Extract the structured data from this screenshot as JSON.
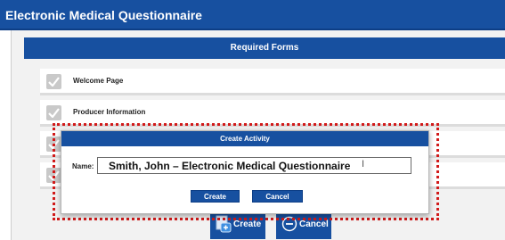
{
  "app": {
    "title": "Electronic Medical Questionnaire"
  },
  "required_forms": {
    "title": "Required Forms",
    "items": [
      {
        "label": "Welcome Page",
        "completed": true
      },
      {
        "label": "Producer Information",
        "completed": true
      },
      {
        "label": "",
        "completed": true
      },
      {
        "label": "",
        "completed": true
      }
    ]
  },
  "actions": {
    "create_label": "Create",
    "cancel_label": "Cancel"
  },
  "modal": {
    "title": "Create Activity",
    "name_label": "Name:",
    "name_value": "Smith, John – Electronic Medical Questionnaire",
    "create_label": "Create",
    "cancel_label": "Cancel"
  },
  "colors": {
    "primary": "#1750a0",
    "highlight": "#d11a1a",
    "check": "#c9c9c9"
  }
}
